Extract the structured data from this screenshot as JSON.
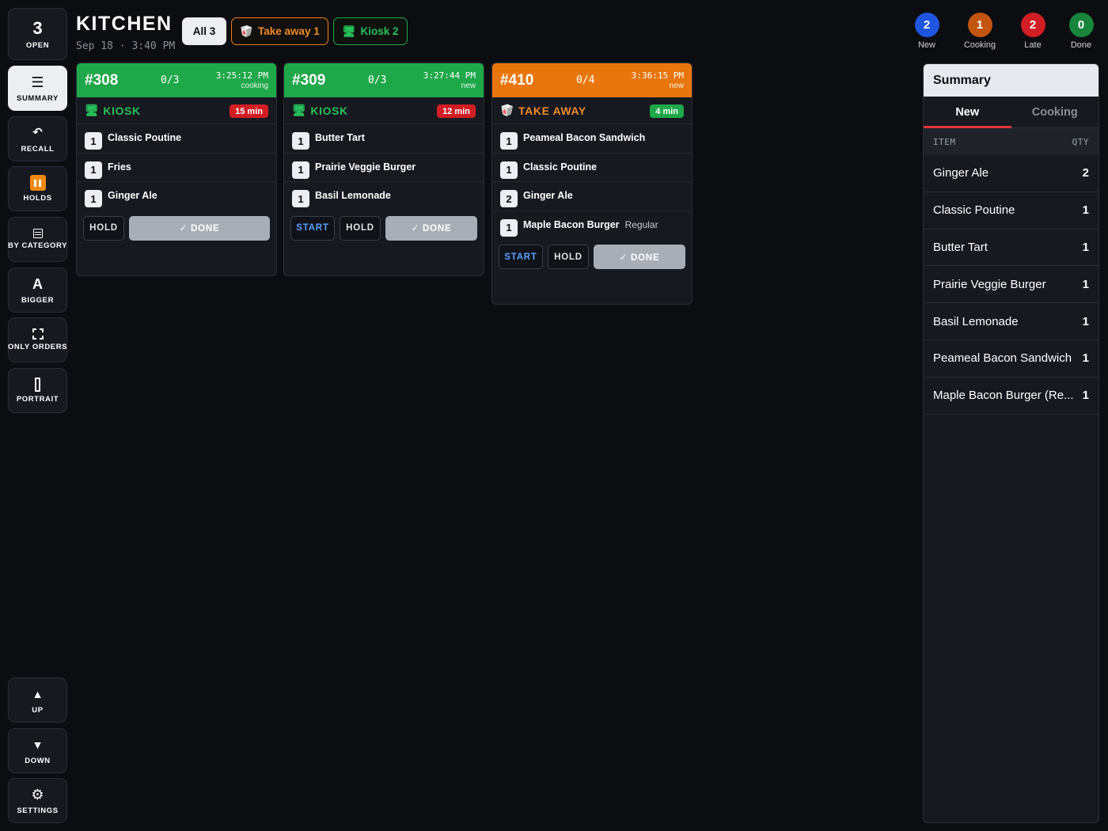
{
  "sidebar": {
    "open_count": "3",
    "open_label": "OPEN",
    "summary_label": "SUMMARY",
    "recall_label": "RECALL",
    "holds_label": "HOLDS",
    "by_category_label": "BY CATEGORY",
    "bigger_glyph": "A",
    "bigger_label": "BIGGER",
    "only_orders_label": "ONLY ORDERS",
    "portrait_label": "PORTRAIT",
    "up_label": "UP",
    "down_label": "DOWN",
    "settings_label": "SETTINGS",
    "icons": [
      "menu-icon",
      "recall-icon",
      "pause-icon",
      "list-icon",
      "focus-icon",
      "portrait-icon",
      "up-arrow-icon",
      "down-arrow-icon",
      "gear-icon"
    ]
  },
  "header": {
    "title": "KITCHEN",
    "datetime": "Sep 18 · 3:40 PM",
    "filters": {
      "all": "All 3",
      "take_away": "Take away 1",
      "kiosk": "Kiosk 2"
    }
  },
  "stats": [
    {
      "count": "2",
      "label": "New",
      "color": "#1f55e0"
    },
    {
      "count": "1",
      "label": "Cooking",
      "color": "#c2550f"
    },
    {
      "count": "2",
      "label": "Late",
      "color": "#d11d24"
    },
    {
      "count": "0",
      "label": "Done",
      "color": "#17853b"
    }
  ],
  "tickets": [
    {
      "number": "#308",
      "progress": "0/3",
      "time": "3:25:12 PM",
      "status": "cooking",
      "source": "KIOSK",
      "age": "15 min",
      "header_color": "#1fa84a",
      "items": [
        {
          "qty": "1",
          "name": "Classic Poutine"
        },
        {
          "qty": "1",
          "name": "Fries"
        },
        {
          "qty": "1",
          "name": "Ginger Ale"
        }
      ],
      "actions": {
        "hold": "HOLD",
        "done": "✓ DONE"
      }
    },
    {
      "number": "#309",
      "progress": "0/3",
      "time": "3:27:44 PM",
      "status": "new",
      "source": "KIOSK",
      "age": "12 min",
      "header_color": "#1fa84a",
      "items": [
        {
          "qty": "1",
          "name": "Butter Tart"
        },
        {
          "qty": "1",
          "name": "Prairie Veggie Burger"
        },
        {
          "qty": "1",
          "name": "Basil Lemonade"
        }
      ],
      "actions": {
        "start": "START",
        "hold": "HOLD",
        "done": "✓ DONE"
      }
    },
    {
      "number": "#410",
      "progress": "0/4",
      "time": "3:36:15 PM",
      "status": "new",
      "source": "TAKE AWAY",
      "age": "4 min",
      "header_color": "#e8760c",
      "items": [
        {
          "qty": "1",
          "name": "Peameal Bacon Sandwich"
        },
        {
          "qty": "1",
          "name": "Classic Poutine"
        },
        {
          "qty": "2",
          "name": "Ginger Ale"
        },
        {
          "qty": "1",
          "name": "Maple Bacon Burger",
          "modifier": "Regular"
        }
      ],
      "actions": {
        "start": "START",
        "hold": "HOLD",
        "done": "✓ DONE"
      }
    }
  ],
  "summary": {
    "title": "Summary",
    "tabs": [
      "New",
      "Cooking"
    ],
    "active_tab": "New",
    "col_item": "ITEM",
    "col_qty": "QTY",
    "rows": [
      {
        "name": "Ginger Ale",
        "qty": "2"
      },
      {
        "name": "Classic Poutine",
        "qty": "1"
      },
      {
        "name": "Butter Tart",
        "qty": "1"
      },
      {
        "name": "Prairie Veggie Burger",
        "qty": "1"
      },
      {
        "name": "Basil Lemonade",
        "qty": "1"
      },
      {
        "name": "Peameal Bacon Sandwich",
        "qty": "1"
      },
      {
        "name": "Maple Bacon Burger (Re...",
        "qty": "1"
      }
    ]
  },
  "colors": {
    "kiosk": "#27c05a",
    "take_away": "#ef8b2a",
    "late_badge": "#d11d24",
    "ok_badge": "#1fa84a",
    "accent_tab": "#e0353a"
  }
}
